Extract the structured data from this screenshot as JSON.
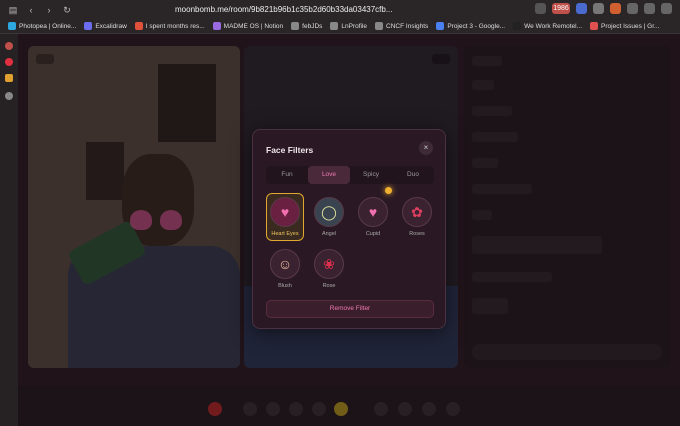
{
  "browser": {
    "url": "moonbomb.me/room/9b821b96b1c35b2d60b33da03437cfb...",
    "badge": "1986"
  },
  "bookmarks": [
    {
      "label": "Photopea | Online...",
      "color": "#2ea8e0"
    },
    {
      "label": "Excalidraw",
      "color": "#6c6cf0"
    },
    {
      "label": "I spent months res...",
      "color": "#e0503a"
    },
    {
      "label": "MADME OS | Notion",
      "color": "#9a6ae0"
    },
    {
      "label": "febJDs",
      "color": "#888888"
    },
    {
      "label": "LnProfile",
      "color": "#888888"
    },
    {
      "label": "CNCF Insights",
      "color": "#888888"
    },
    {
      "label": "Project 3 - Google...",
      "color": "#4a80f0"
    },
    {
      "label": "We Work Remotel...",
      "color": "#222222"
    },
    {
      "label": "Project Issues | Gr...",
      "color": "#e05050"
    }
  ],
  "modal": {
    "title": "Face Filters",
    "close": "×",
    "tabs": [
      "Fun",
      "Love",
      "Spicy",
      "Duo"
    ],
    "active_tab": "Love",
    "filters": [
      {
        "label": "Heart Eyes",
        "icon": "heart-eyes-icon",
        "glyph": "♥",
        "selected": true
      },
      {
        "label": "Angel",
        "icon": "angel-icon",
        "glyph": "◯",
        "selected": false
      },
      {
        "label": "Cupid",
        "icon": "cupid-icon",
        "glyph": "♥",
        "selected": false
      },
      {
        "label": "Roses",
        "icon": "roses-icon",
        "glyph": "✿",
        "selected": false
      },
      {
        "label": "Blush",
        "icon": "blush-icon",
        "glyph": "☺",
        "selected": false
      },
      {
        "label": "Rose",
        "icon": "rose-icon",
        "glyph": "❀",
        "selected": false
      }
    ],
    "remove_label": "Remove Filter"
  },
  "colors": {
    "accent": "#f07ab0",
    "selected": "#e0a830"
  }
}
